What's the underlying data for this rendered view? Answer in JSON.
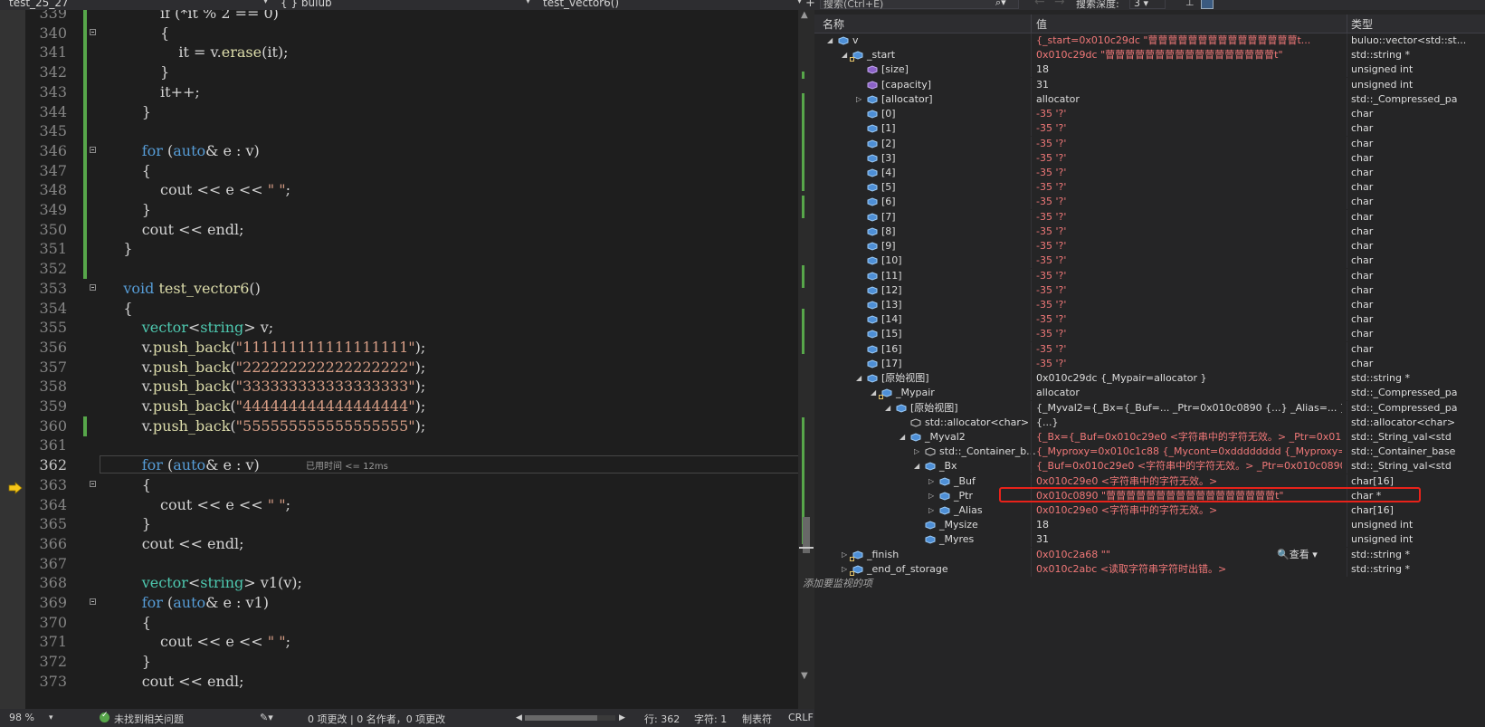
{
  "editor": {
    "nav": {
      "file": "test_25_27",
      "scope": "{ } bulub",
      "function": "test_vector6()"
    },
    "lines": [
      {
        "num": "339",
        "code": [
          {
            "c": "",
            "t": "            if (*it % 2 == 0)"
          }
        ]
      },
      {
        "num": "340",
        "code": [
          {
            "c": "",
            "t": "            {"
          }
        ]
      },
      {
        "num": "341",
        "code": [
          {
            "c": "",
            "t": "                it = v."
          },
          {
            "c": "f",
            "t": "erase"
          },
          {
            "c": "",
            "t": "(it);"
          }
        ]
      },
      {
        "num": "342",
        "code": [
          {
            "c": "",
            "t": "            }"
          }
        ]
      },
      {
        "num": "343",
        "code": [
          {
            "c": "",
            "t": "            it++;"
          }
        ]
      },
      {
        "num": "344",
        "code": [
          {
            "c": "",
            "t": "        }"
          }
        ]
      },
      {
        "num": "345",
        "code": [
          {
            "c": "",
            "t": ""
          }
        ]
      },
      {
        "num": "346",
        "code": [
          {
            "c": "",
            "t": "        "
          },
          {
            "c": "k",
            "t": "for"
          },
          {
            "c": "",
            "t": " ("
          },
          {
            "c": "k",
            "t": "auto"
          },
          {
            "c": "",
            "t": "& e : v)"
          }
        ]
      },
      {
        "num": "347",
        "code": [
          {
            "c": "",
            "t": "        {"
          }
        ]
      },
      {
        "num": "348",
        "code": [
          {
            "c": "",
            "t": "            cout << e << "
          },
          {
            "c": "s",
            "t": "\" \""
          },
          {
            "c": "",
            "t": ";"
          }
        ]
      },
      {
        "num": "349",
        "code": [
          {
            "c": "",
            "t": "        }"
          }
        ]
      },
      {
        "num": "350",
        "code": [
          {
            "c": "",
            "t": "        cout << endl;"
          }
        ]
      },
      {
        "num": "351",
        "code": [
          {
            "c": "",
            "t": "    }"
          }
        ]
      },
      {
        "num": "352",
        "code": [
          {
            "c": "",
            "t": ""
          }
        ]
      },
      {
        "num": "353",
        "code": [
          {
            "c": "",
            "t": "    "
          },
          {
            "c": "k",
            "t": "void"
          },
          {
            "c": "",
            "t": " "
          },
          {
            "c": "f",
            "t": "test_vector6"
          },
          {
            "c": "",
            "t": "()"
          }
        ]
      },
      {
        "num": "354",
        "code": [
          {
            "c": "",
            "t": "    {"
          }
        ]
      },
      {
        "num": "355",
        "code": [
          {
            "c": "",
            "t": "        "
          },
          {
            "c": "t",
            "t": "vector"
          },
          {
            "c": "",
            "t": "<"
          },
          {
            "c": "t",
            "t": "string"
          },
          {
            "c": "",
            "t": "> v;"
          }
        ]
      },
      {
        "num": "356",
        "code": [
          {
            "c": "",
            "t": "        v."
          },
          {
            "c": "f",
            "t": "push_back"
          },
          {
            "c": "",
            "t": "("
          },
          {
            "c": "s",
            "t": "\"111111111111111111\""
          },
          {
            "c": "",
            "t": ");"
          }
        ]
      },
      {
        "num": "357",
        "code": [
          {
            "c": "",
            "t": "        v."
          },
          {
            "c": "f",
            "t": "push_back"
          },
          {
            "c": "",
            "t": "("
          },
          {
            "c": "s",
            "t": "\"222222222222222222\""
          },
          {
            "c": "",
            "t": ");"
          }
        ]
      },
      {
        "num": "358",
        "code": [
          {
            "c": "",
            "t": "        v."
          },
          {
            "c": "f",
            "t": "push_back"
          },
          {
            "c": "",
            "t": "("
          },
          {
            "c": "s",
            "t": "\"333333333333333333\""
          },
          {
            "c": "",
            "t": ");"
          }
        ]
      },
      {
        "num": "359",
        "code": [
          {
            "c": "",
            "t": "        v."
          },
          {
            "c": "f",
            "t": "push_back"
          },
          {
            "c": "",
            "t": "("
          },
          {
            "c": "s",
            "t": "\"444444444444444444\""
          },
          {
            "c": "",
            "t": ");"
          }
        ]
      },
      {
        "num": "360",
        "code": [
          {
            "c": "",
            "t": "        v."
          },
          {
            "c": "f",
            "t": "push_back"
          },
          {
            "c": "",
            "t": "("
          },
          {
            "c": "s",
            "t": "\"555555555555555555\""
          },
          {
            "c": "",
            "t": ");"
          }
        ]
      },
      {
        "num": "361",
        "code": [
          {
            "c": "",
            "t": ""
          }
        ]
      },
      {
        "num": "362",
        "code": [
          {
            "c": "",
            "t": "        "
          },
          {
            "c": "k",
            "t": "for"
          },
          {
            "c": "",
            "t": " ("
          },
          {
            "c": "k",
            "t": "auto"
          },
          {
            "c": "",
            "t": "& e : v)"
          }
        ]
      },
      {
        "num": "363",
        "code": [
          {
            "c": "",
            "t": "        {"
          }
        ]
      },
      {
        "num": "364",
        "code": [
          {
            "c": "",
            "t": "            cout << e << "
          },
          {
            "c": "s",
            "t": "\" \""
          },
          {
            "c": "",
            "t": ";"
          }
        ]
      },
      {
        "num": "365",
        "code": [
          {
            "c": "",
            "t": "        }"
          }
        ]
      },
      {
        "num": "366",
        "code": [
          {
            "c": "",
            "t": "        cout << endl;"
          }
        ]
      },
      {
        "num": "367",
        "code": [
          {
            "c": "",
            "t": ""
          }
        ]
      },
      {
        "num": "368",
        "code": [
          {
            "c": "",
            "t": "        "
          },
          {
            "c": "t",
            "t": "vector"
          },
          {
            "c": "",
            "t": "<"
          },
          {
            "c": "t",
            "t": "string"
          },
          {
            "c": "",
            "t": "> v1(v);"
          }
        ]
      },
      {
        "num": "369",
        "code": [
          {
            "c": "",
            "t": "        "
          },
          {
            "c": "k",
            "t": "for"
          },
          {
            "c": "",
            "t": " ("
          },
          {
            "c": "k",
            "t": "auto"
          },
          {
            "c": "",
            "t": "& e : v1)"
          }
        ]
      },
      {
        "num": "370",
        "code": [
          {
            "c": "",
            "t": "        {"
          }
        ]
      },
      {
        "num": "371",
        "code": [
          {
            "c": "",
            "t": "            cout << e << "
          },
          {
            "c": "s",
            "t": "\" \""
          },
          {
            "c": "",
            "t": ";"
          }
        ]
      },
      {
        "num": "372",
        "code": [
          {
            "c": "",
            "t": "        }"
          }
        ]
      },
      {
        "num": "373",
        "code": [
          {
            "c": "",
            "t": "        cout << endl;"
          }
        ]
      }
    ],
    "current_line": "362",
    "elapsed_hint": "已用时间 <= 12ms",
    "fold_lines": [
      "340",
      "346",
      "353",
      "363",
      "369"
    ],
    "changed_lines": [
      "339",
      "340",
      "341",
      "342",
      "343",
      "344",
      "345",
      "346",
      "347",
      "348",
      "349",
      "350",
      "351",
      "352",
      "360"
    ]
  },
  "status": {
    "zoom": "98 %",
    "issues": "未找到相关问题",
    "changes": "0 项更改 | 0 名作者，0 项更改",
    "line": "行: 362",
    "char": "字符: 1",
    "tabs": "制表符",
    "eol": "CRLF"
  },
  "watch": {
    "search_placeholder": "搜索(Ctrl+E)",
    "depth_label": "搜索深度:",
    "depth_value": "3",
    "columns": {
      "name": "名称",
      "value": "值",
      "type": "类型"
    },
    "view_label": "查看",
    "add_item": "添加要监视的项",
    "rows": [
      {
        "lvl": 0,
        "exp": "open",
        "icon": "obj",
        "name": "v",
        "value": "{_start=0x010c29dc \"萺萺萺萺萺萺萺萺萺萺萺萺萺萺萺t...",
        "type": "buluo::vector<std::st..."
      },
      {
        "lvl": 1,
        "exp": "open",
        "icon": "field-locked",
        "name": "_start",
        "value": "0x010c29dc \"萺萺萺萺萺萺萺萺萺萺萺萺萺萺萺萺萺t\"",
        "type": "std::string *"
      },
      {
        "lvl": 2,
        "exp": "none",
        "icon": "prop",
        "name": "[size]",
        "value": "18",
        "plain": true,
        "type": "unsigned int"
      },
      {
        "lvl": 2,
        "exp": "none",
        "icon": "prop",
        "name": "[capacity]",
        "value": "31",
        "plain": true,
        "type": "unsigned int"
      },
      {
        "lvl": 2,
        "exp": "closed",
        "icon": "obj",
        "name": "[allocator]",
        "value": "allocator",
        "plain": true,
        "type": "std::_Compressed_pa"
      },
      {
        "lvl": 2,
        "exp": "none",
        "icon": "obj",
        "name": "[0]",
        "value": "-35 '?'",
        "type": "char"
      },
      {
        "lvl": 2,
        "exp": "none",
        "icon": "obj",
        "name": "[1]",
        "value": "-35 '?'",
        "type": "char"
      },
      {
        "lvl": 2,
        "exp": "none",
        "icon": "obj",
        "name": "[2]",
        "value": "-35 '?'",
        "type": "char"
      },
      {
        "lvl": 2,
        "exp": "none",
        "icon": "obj",
        "name": "[3]",
        "value": "-35 '?'",
        "type": "char"
      },
      {
        "lvl": 2,
        "exp": "none",
        "icon": "obj",
        "name": "[4]",
        "value": "-35 '?'",
        "type": "char"
      },
      {
        "lvl": 2,
        "exp": "none",
        "icon": "obj",
        "name": "[5]",
        "value": "-35 '?'",
        "type": "char"
      },
      {
        "lvl": 2,
        "exp": "none",
        "icon": "obj",
        "name": "[6]",
        "value": "-35 '?'",
        "type": "char"
      },
      {
        "lvl": 2,
        "exp": "none",
        "icon": "obj",
        "name": "[7]",
        "value": "-35 '?'",
        "type": "char"
      },
      {
        "lvl": 2,
        "exp": "none",
        "icon": "obj",
        "name": "[8]",
        "value": "-35 '?'",
        "type": "char"
      },
      {
        "lvl": 2,
        "exp": "none",
        "icon": "obj",
        "name": "[9]",
        "value": "-35 '?'",
        "type": "char"
      },
      {
        "lvl": 2,
        "exp": "none",
        "icon": "obj",
        "name": "[10]",
        "value": "-35 '?'",
        "type": "char"
      },
      {
        "lvl": 2,
        "exp": "none",
        "icon": "obj",
        "name": "[11]",
        "value": "-35 '?'",
        "type": "char"
      },
      {
        "lvl": 2,
        "exp": "none",
        "icon": "obj",
        "name": "[12]",
        "value": "-35 '?'",
        "type": "char"
      },
      {
        "lvl": 2,
        "exp": "none",
        "icon": "obj",
        "name": "[13]",
        "value": "-35 '?'",
        "type": "char"
      },
      {
        "lvl": 2,
        "exp": "none",
        "icon": "obj",
        "name": "[14]",
        "value": "-35 '?'",
        "type": "char"
      },
      {
        "lvl": 2,
        "exp": "none",
        "icon": "obj",
        "name": "[15]",
        "value": "-35 '?'",
        "type": "char"
      },
      {
        "lvl": 2,
        "exp": "none",
        "icon": "obj",
        "name": "[16]",
        "value": "-35 '?'",
        "type": "char"
      },
      {
        "lvl": 2,
        "exp": "none",
        "icon": "obj",
        "name": "[17]",
        "value": "-35 '?'",
        "type": "char"
      },
      {
        "lvl": 2,
        "exp": "open",
        "icon": "obj",
        "name": "[原始视图]",
        "value": "0x010c29dc {_Mypair=allocator }",
        "plain": true,
        "type": "std::string *"
      },
      {
        "lvl": 3,
        "exp": "open",
        "icon": "field-locked",
        "name": "_Mypair",
        "value": "allocator",
        "plain": true,
        "type": "std::_Compressed_pa"
      },
      {
        "lvl": 4,
        "exp": "open",
        "icon": "obj",
        "name": "[原始视图]",
        "value": "{_Myval2={_Bx={_Buf=... _Ptr=0x010c0890 {...} _Alias=... } _Mysize=...",
        "plain": true,
        "type": "std::_Compressed_pa"
      },
      {
        "lvl": 5,
        "exp": "none",
        "icon": "base",
        "name": "std::allocator<char>",
        "value": "{...}",
        "plain": true,
        "type": "std::allocator<char>"
      },
      {
        "lvl": 5,
        "exp": "open",
        "icon": "obj",
        "name": "_Myval2",
        "value": "{_Bx={_Buf=0x010c29e0 <字符串中的字符无效。> _Ptr=0x010c0...",
        "type": "std::_String_val<std"
      },
      {
        "lvl": 6,
        "exp": "closed",
        "icon": "base",
        "name": "std::_Container_b...",
        "value": "{_Myproxy=0x010c1c88 {_Mycont=0xdddddddd {_Myproxy=??? } _...",
        "type": "std::_Container_base"
      },
      {
        "lvl": 6,
        "exp": "open",
        "icon": "obj",
        "name": "_Bx",
        "value": "{_Buf=0x010c29e0 <字符串中的字符无效。> _Ptr=0x010c0890 \"...",
        "type": "std::_String_val<std"
      },
      {
        "lvl": 7,
        "exp": "closed",
        "icon": "obj",
        "name": "_Buf",
        "value": "0x010c29e0 <字符串中的字符无效。>",
        "type": "char[16]"
      },
      {
        "lvl": 7,
        "exp": "closed",
        "icon": "obj",
        "name": "_Ptr",
        "value": "0x010c0890 \"萺萺萺萺萺萺萺萺萺萺萺萺萺萺萺萺萺t\"",
        "type": "char *"
      },
      {
        "lvl": 7,
        "exp": "closed",
        "icon": "obj",
        "name": "_Alias",
        "value": "0x010c29e0 <字符串中的字符无效。>",
        "type": "char[16]"
      },
      {
        "lvl": 6,
        "exp": "none",
        "icon": "obj",
        "name": "_Mysize",
        "value": "18",
        "plain": true,
        "type": "unsigned int"
      },
      {
        "lvl": 6,
        "exp": "none",
        "icon": "obj",
        "name": "_Myres",
        "value": "31",
        "plain": true,
        "type": "unsigned int"
      },
      {
        "lvl": 1,
        "exp": "closed",
        "icon": "field-locked",
        "name": "_finish",
        "value": "0x010c2a68 \"\"",
        "type": "std::string *"
      },
      {
        "lvl": 1,
        "exp": "closed",
        "icon": "field-locked",
        "name": "_end_of_storage",
        "value": "0x010c2abc <读取字符串字符时出错。>",
        "type": "std::string *"
      }
    ]
  },
  "colors": {
    "accent_green": "#57a64a",
    "highlight_red": "#e8221a",
    "error_value": "#f07878"
  }
}
